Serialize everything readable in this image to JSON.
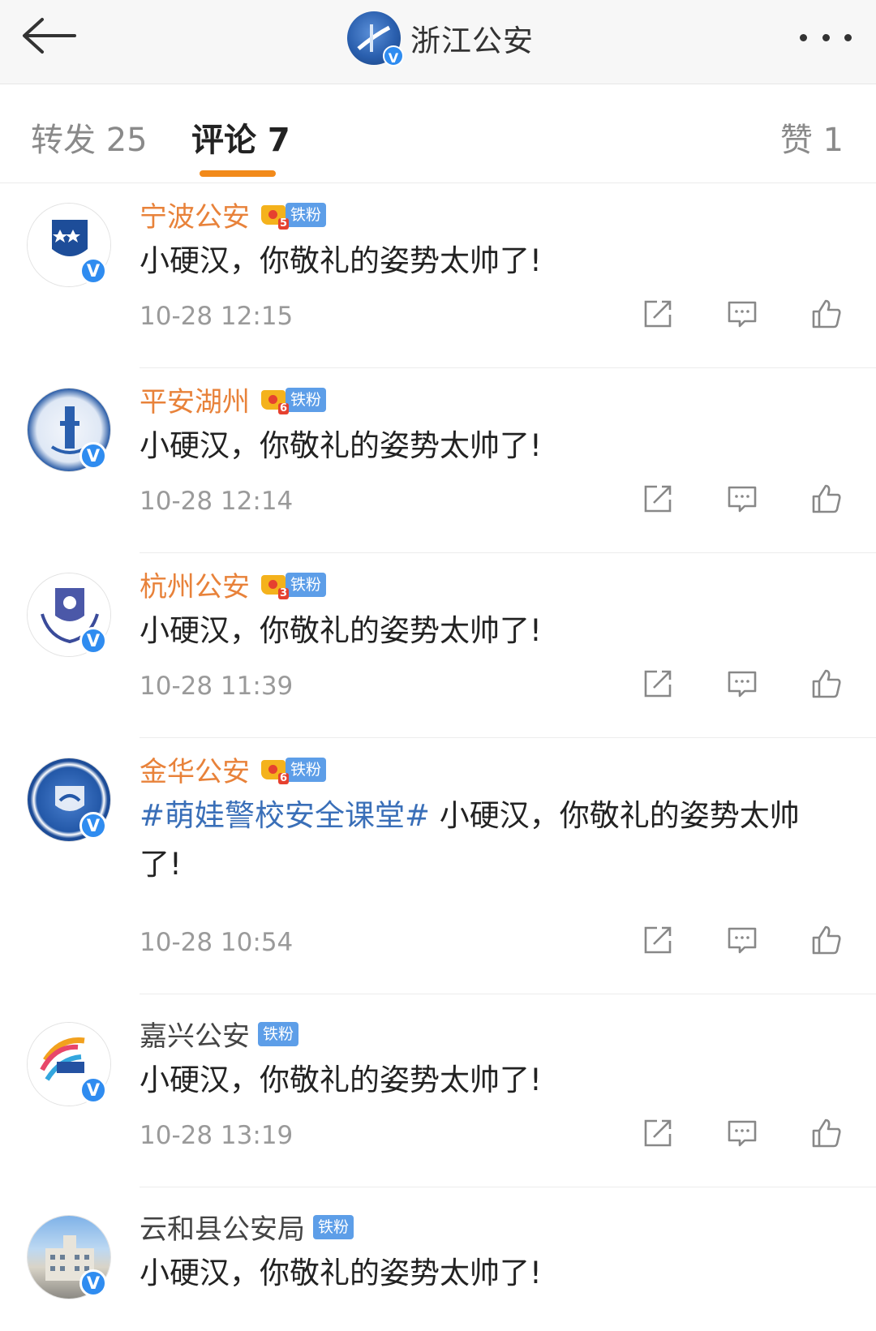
{
  "header": {
    "title": "浙江公安",
    "back_icon": "arrow-left-icon",
    "more_icon": "more-dots-icon"
  },
  "tabs": {
    "repost": "转发 25",
    "comment": "评论 7",
    "like": "赞 1",
    "active_color": "#f28a1a"
  },
  "comments": [
    {
      "name": "宁波公安",
      "level": "5",
      "badge": "铁粉",
      "hashtag": "",
      "text": "小硬汉，你敬礼的姿势太帅了!",
      "time": "10-28 12:15",
      "verified": "V"
    },
    {
      "name": "平安湖州",
      "level": "6",
      "badge": "铁粉",
      "hashtag": "",
      "text": "小硬汉，你敬礼的姿势太帅了!",
      "time": "10-28 12:14",
      "verified": "V"
    },
    {
      "name": "杭州公安",
      "level": "3",
      "badge": "铁粉",
      "hashtag": "",
      "text": "小硬汉，你敬礼的姿势太帅了!",
      "time": "10-28 11:39",
      "verified": "V"
    },
    {
      "name": "金华公安",
      "level": "6",
      "badge": "铁粉",
      "hashtag": "#萌娃警校安全课堂#",
      "text": " 小硬汉，你敬礼的姿势太帅了!",
      "time": "10-28 10:54",
      "verified": "V"
    },
    {
      "name": "嘉兴公安",
      "level": "",
      "badge": "铁粉",
      "hashtag": "",
      "text": "小硬汉，你敬礼的姿势太帅了!",
      "time": "10-28 13:19",
      "verified": "V"
    },
    {
      "name": "云和县公安局",
      "level": "",
      "badge": "铁粉",
      "hashtag": "",
      "text": " 小硬汉，你敬礼的姿势太帅了!",
      "time": "",
      "verified": "V"
    }
  ],
  "icons": {
    "repost": "repost-icon",
    "reply": "comment-icon",
    "like": "thumbs-up-icon"
  },
  "colors": {
    "name_highlight": "#e8823a",
    "hashtag": "#3a6fb8",
    "verified": "#2f8cf0",
    "fan_badge": "#5d9ee8"
  }
}
